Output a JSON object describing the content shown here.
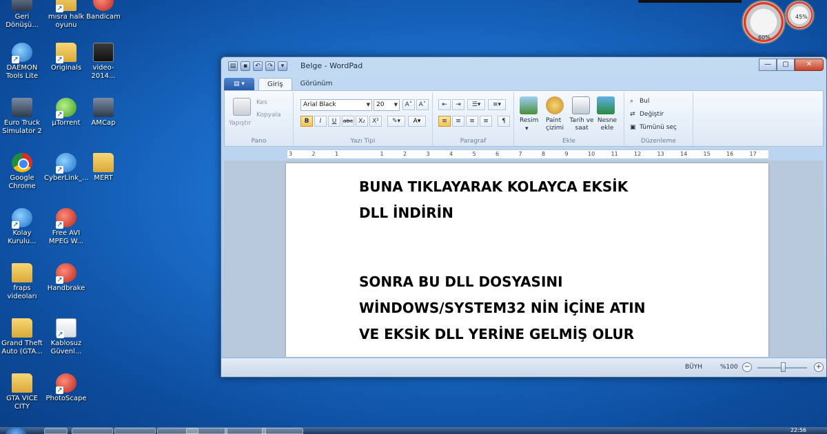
{
  "desktop": {
    "icons": [
      {
        "label": "Geri Dönüşü...",
        "type": "app-dark"
      },
      {
        "label": "mısra halk oyunu",
        "type": "folder"
      },
      {
        "label": "Bandicam",
        "type": "app-red"
      },
      {
        "label": "DAEMON Tools Lite",
        "type": "app-blue"
      },
      {
        "label": "Originals",
        "type": "folder"
      },
      {
        "label": "video-2014...",
        "type": "video"
      },
      {
        "label": "Euro Truck Simulator 2",
        "type": "app-dark"
      },
      {
        "label": "µTorrent",
        "type": "app-green"
      },
      {
        "label": "AMCap",
        "type": "app-dark"
      },
      {
        "label": "Google Chrome",
        "type": "chrome"
      },
      {
        "label": "CyberLink_...",
        "type": "app-blue"
      },
      {
        "label": "MERT",
        "type": "folder"
      },
      {
        "label": "Kolay Kurulu...",
        "type": "app-blue"
      },
      {
        "label": "Free AVI MPEG W...",
        "type": "app-red"
      },
      {
        "label": "fraps videoları",
        "type": "folder"
      },
      {
        "label": "Handbrake",
        "type": "app-red"
      },
      {
        "label": "Grand Theft Auto (GTA...",
        "type": "folder"
      },
      {
        "label": "Kablosuz Güvenl...",
        "type": "doc"
      },
      {
        "label": "GTA VICE CITY",
        "type": "folder"
      },
      {
        "label": "PhotoScape",
        "type": "app-red"
      }
    ]
  },
  "gadget": {
    "cpu": "60%",
    "mem": "45%"
  },
  "window": {
    "title": "Belge - WordPad",
    "tabs": [
      "Giriş",
      "Görünüm"
    ],
    "ribbon": {
      "pano": {
        "paste": "Yapıştır",
        "cut": "Kes",
        "copy": "Kopyala",
        "label": "Pano"
      },
      "font": {
        "family": "Arial Black",
        "size": "20",
        "label": "Yazı Tipi",
        "bold": "B",
        "italic": "I",
        "underline": "U",
        "strike": "abc",
        "sub": "X₂",
        "sup": "X²"
      },
      "paragraph": {
        "label": "Paragraf"
      },
      "insert": {
        "picture": "Resim",
        "paint": "Paint çizimi",
        "datetime": "Tarih ve saat",
        "object": "Nesne ekle",
        "label": "Ekle"
      },
      "edit": {
        "find": "Bul",
        "replace": "Değiştir",
        "selectall": "Tümünü seç",
        "label": "Düzenleme"
      }
    },
    "ruler": [
      "3",
      "2",
      "1",
      "1",
      "2",
      "3",
      "4",
      "5",
      "6",
      "7",
      "8",
      "9",
      "10",
      "11",
      "12",
      "13",
      "14",
      "15",
      "16",
      "17"
    ],
    "document": {
      "lines": [
        "BUNA TIKLAYARAK KOLAYCA EKSİK",
        "DLL İNDİRİN",
        "SONRA BU DLL DOSYASINI",
        "WİNDOWS/SYSTEM32 NİN İÇİNE ATIN",
        "VE EKSİK DLL YERİNE GELMİŞ OLUR"
      ]
    },
    "status": {
      "caps": "BÜYH",
      "zoom": "%100"
    }
  },
  "taskbar": {
    "time": "22:56"
  }
}
